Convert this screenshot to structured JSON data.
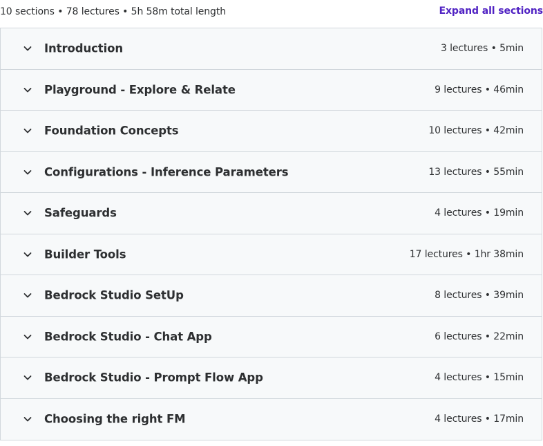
{
  "summary": {
    "text": "10 sections • 78 lectures • 5h 58m total length",
    "expand_label": "Expand all sections"
  },
  "colors": {
    "accent": "#5022c3",
    "row_background": "#f7f9fa",
    "border": "#d1d7dc",
    "text": "#2d2f31"
  },
  "icons": {
    "section_toggle": "chevron-down-icon"
  },
  "sections": [
    {
      "title": "Introduction",
      "meta": "3 lectures • 5min"
    },
    {
      "title": "Playground - Explore & Relate",
      "meta": "9 lectures • 46min"
    },
    {
      "title": "Foundation Concepts",
      "meta": "10 lectures • 42min"
    },
    {
      "title": "Configurations - Inference Parameters",
      "meta": "13 lectures • 55min"
    },
    {
      "title": "Safeguards",
      "meta": "4 lectures • 19min"
    },
    {
      "title": "Builder Tools",
      "meta": "17 lectures • 1hr 38min"
    },
    {
      "title": "Bedrock Studio SetUp",
      "meta": "8 lectures • 39min"
    },
    {
      "title": "Bedrock Studio - Chat App",
      "meta": "6 lectures • 22min"
    },
    {
      "title": "Bedrock Studio - Prompt Flow App",
      "meta": "4 lectures • 15min"
    },
    {
      "title": "Choosing the right FM",
      "meta": "4 lectures • 17min"
    }
  ]
}
